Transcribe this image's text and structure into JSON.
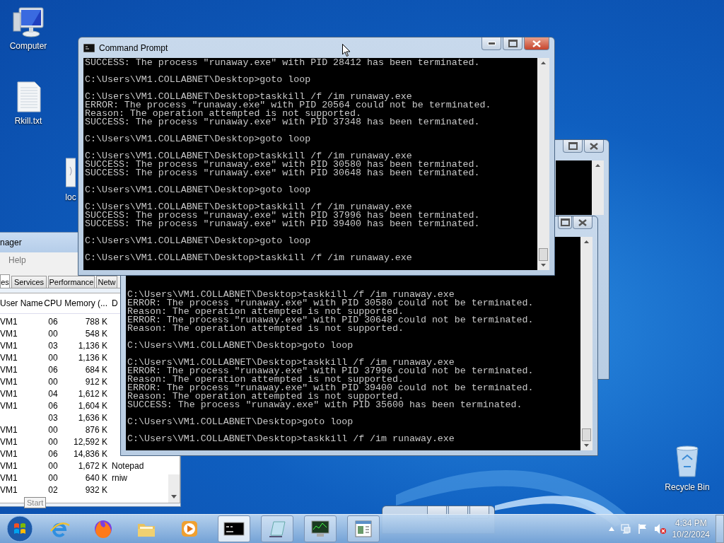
{
  "desktop_icons": [
    {
      "kind": "computer",
      "label": "Computer"
    },
    {
      "kind": "text-file",
      "label": "Rkill.txt"
    },
    {
      "kind": "file",
      "label": "loc"
    },
    {
      "kind": "recycle-bin",
      "label": "Recycle Bin"
    }
  ],
  "task_manager": {
    "title": "nager",
    "menu": [
      "Help"
    ],
    "tabs": [
      {
        "label": "es",
        "selected": true
      },
      {
        "label": "Services",
        "selected": false
      },
      {
        "label": "Performance",
        "selected": false
      },
      {
        "label": "Netw",
        "selected": false
      }
    ],
    "columns": [
      "User Name",
      "CPU",
      "Memory (...",
      "D"
    ],
    "rows": [
      {
        "user": "VM1",
        "cpu": "06",
        "memory": "788 K"
      },
      {
        "user": "VM1",
        "cpu": "00",
        "memory": "548 K"
      },
      {
        "user": "VM1",
        "cpu": "03",
        "memory": "1,136 K"
      },
      {
        "user": "VM1",
        "cpu": "00",
        "memory": "1,136 K"
      },
      {
        "user": "VM1",
        "cpu": "06",
        "memory": "684 K"
      },
      {
        "user": "VM1",
        "cpu": "00",
        "memory": "912 K"
      },
      {
        "user": "VM1",
        "cpu": "04",
        "memory": "1,612 K"
      },
      {
        "user": "VM1",
        "cpu": "06",
        "memory": "1,604 K"
      },
      {
        "cpu": "03",
        "memory": "1,636 K"
      },
      {
        "user": "VM1",
        "cpu": "00",
        "memory": "876 K"
      },
      {
        "user": "VM1",
        "cpu": "00",
        "memory": "12,592 K"
      },
      {
        "user": "VM1",
        "cpu": "06",
        "memory": "14,836 K"
      },
      {
        "user": "VM1",
        "cpu": "00",
        "memory": "1,672 K",
        "description": "Notepad"
      },
      {
        "user": "VM1",
        "cpu": "00",
        "memory": "640 K",
        "description": "rniw"
      },
      {
        "user": "VM1",
        "cpu": "02",
        "memory": "932 K"
      }
    ]
  },
  "command_prompts": [
    {
      "title": "Command Prompt",
      "blocks": [
        [
          "SUCCESS: The process \"runaway.exe\" with PID 28412 has been terminated."
        ],
        [
          "C:\\Users\\VM1.COLLABNET\\Desktop>goto loop"
        ],
        [
          "C:\\Users\\VM1.COLLABNET\\Desktop>taskkill /f /im runaway.exe",
          "ERROR: The process \"runaway.exe\" with PID 20564 could not be terminated.",
          "Reason: The operation attempted is not supported.",
          "SUCCESS: The process \"runaway.exe\" with PID 37348 has been terminated."
        ],
        [
          "C:\\Users\\VM1.COLLABNET\\Desktop>goto loop"
        ],
        [
          "C:\\Users\\VM1.COLLABNET\\Desktop>taskkill /f /im runaway.exe",
          "SUCCESS: The process \"runaway.exe\" with PID 30580 has been terminated.",
          "SUCCESS: The process \"runaway.exe\" with PID 30648 has been terminated."
        ],
        [
          "C:\\Users\\VM1.COLLABNET\\Desktop>goto loop"
        ],
        [
          "C:\\Users\\VM1.COLLABNET\\Desktop>taskkill /f /im runaway.exe",
          "SUCCESS: The process \"runaway.exe\" with PID 37996 has been terminated.",
          "SUCCESS: The process \"runaway.exe\" with PID 39400 has been terminated."
        ],
        [
          "C:\\Users\\VM1.COLLABNET\\Desktop>goto loop"
        ],
        [
          "C:\\Users\\VM1.COLLABNET\\Desktop>taskkill /f /im runaway.exe"
        ]
      ]
    },
    {
      "blocks": [
        [
          "C:\\Users\\VM1.COLLABNET\\Desktop>taskkill /f /im runaway.exe",
          "ERROR: The process \"runaway.exe\" with PID 30580 could not be terminated.",
          "Reason: The operation attempted is not supported.",
          "ERROR: The process \"runaway.exe\" with PID 30648 could not be terminated.",
          "Reason: The operation attempted is not supported."
        ],
        [
          "C:\\Users\\VM1.COLLABNET\\Desktop>goto loop"
        ],
        [
          "C:\\Users\\VM1.COLLABNET\\Desktop>taskkill /f /im runaway.exe",
          "ERROR: The process \"runaway.exe\" with PID 37996 could not be terminated.",
          "Reason: The operation attempted is not supported.",
          "ERROR: The process \"runaway.exe\" with PID 39400 could not be terminated.",
          "Reason: The operation attempted is not supported.",
          "SUCCESS: The process \"runaway.exe\" with PID 35600 has been terminated."
        ],
        [
          "C:\\Users\\VM1.COLLABNET\\Desktop>goto loop"
        ],
        [
          "C:\\Users\\VM1.COLLABNET\\Desktop>taskkill /f /im runaway.exe"
        ]
      ]
    }
  ],
  "tooltip": "Start",
  "taskbar": {
    "items": [
      {
        "kind": "browser",
        "running": false,
        "selected": false
      },
      {
        "kind": "firefox",
        "running": false,
        "selected": false
      },
      {
        "kind": "folder",
        "running": false,
        "selected": false
      },
      {
        "kind": "media",
        "running": false,
        "selected": false
      },
      {
        "kind": "console",
        "running": true,
        "selected": true
      },
      {
        "kind": "notepad",
        "running": true,
        "selected": false
      },
      {
        "kind": "monitor",
        "running": true,
        "selected": false
      },
      {
        "kind": "window",
        "running": true,
        "selected": false
      }
    ],
    "time": "4:34 PM",
    "date": "10/2/2024"
  }
}
